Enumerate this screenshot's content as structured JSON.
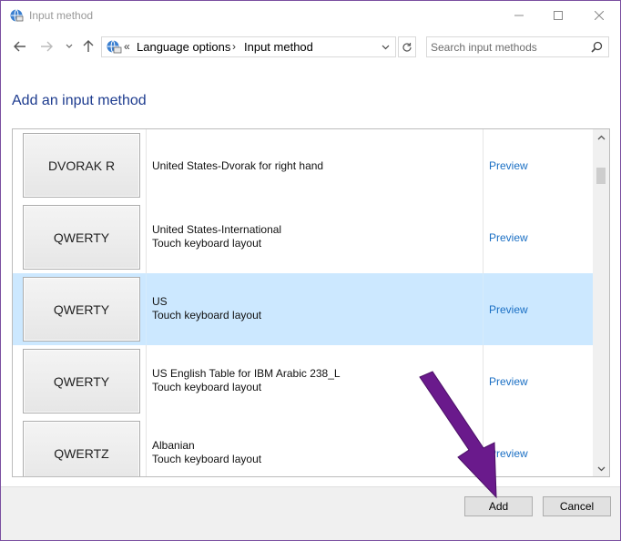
{
  "window": {
    "title": "Input method",
    "minimize_glyph": "—",
    "maximize_glyph": "☐",
    "close_glyph": "✕"
  },
  "nav": {
    "back_icon": "arrow-left-icon",
    "forward_icon": "arrow-right-icon",
    "recent_icon": "chevron-down-icon",
    "up_icon": "arrow-up-icon",
    "breadcrumb_overflow": "«",
    "breadcrumb": [
      "Language options",
      "Input method"
    ],
    "separator": "›",
    "refresh_icon": "refresh-icon"
  },
  "search": {
    "placeholder": "Search input methods",
    "value": ""
  },
  "heading": "Add an input method",
  "methods": [
    {
      "layout": "DVORAK R",
      "line1": "United States-Dvorak for right hand",
      "line2": "",
      "preview": "Preview",
      "selected": false
    },
    {
      "layout": "QWERTY",
      "line1": "United States-International",
      "line2": "Touch keyboard layout",
      "preview": "Preview",
      "selected": false
    },
    {
      "layout": "QWERTY",
      "line1": "US",
      "line2": "Touch keyboard layout",
      "preview": "Preview",
      "selected": true
    },
    {
      "layout": "QWERTY",
      "line1": "US English Table for IBM Arabic 238_L",
      "line2": "Touch keyboard layout",
      "preview": "Preview",
      "selected": false
    },
    {
      "layout": "QWERTZ",
      "line1": "Albanian",
      "line2": "Touch keyboard layout",
      "preview": "Preview",
      "selected": false
    }
  ],
  "buttons": {
    "add": "Add",
    "cancel": "Cancel"
  },
  "colors": {
    "accent": "#1e3c8f",
    "link": "#1a6fc4",
    "selection": "#cce8ff",
    "annotation_arrow": "#6a1a8c"
  }
}
